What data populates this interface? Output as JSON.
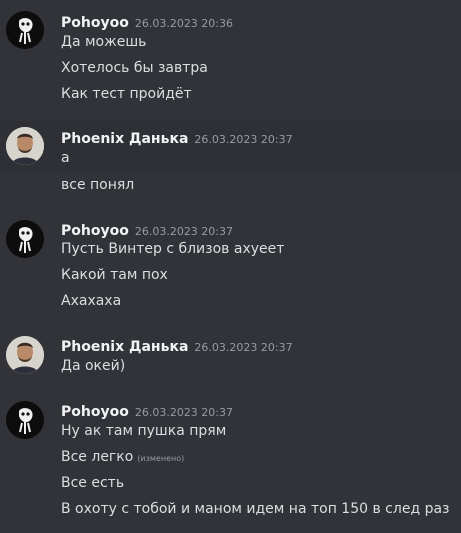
{
  "groups": [
    {
      "author": "Pohoyoo",
      "timestamp": "26.03.2023 20:36",
      "avatar": "dark-sketch-avatar",
      "messages": [
        "Да можешь",
        "Хотелось бы завтра",
        "Как тест пройдёт"
      ]
    },
    {
      "author": "Phoenix Данька",
      "timestamp": "26.03.2023 20:37",
      "avatar": "photo-avatar",
      "messages": [
        "а",
        "все понял"
      ]
    },
    {
      "author": "Pohoyoo",
      "timestamp": "26.03.2023 20:37",
      "avatar": "dark-sketch-avatar",
      "messages": [
        "Пусть Винтер с близов ахуеет",
        "Какой там пох",
        "Ахахаха"
      ]
    },
    {
      "author": "Phoenix Данька",
      "timestamp": "26.03.2023 20:37",
      "avatar": "photo-avatar",
      "messages": [
        "Да окей)"
      ]
    },
    {
      "author": "Pohoyoo",
      "timestamp": "26.03.2023 20:37",
      "avatar": "dark-sketch-avatar",
      "messages": [
        "Ну ак там пушка прям",
        "Все легко",
        "Все есть",
        "В охоту с тобой и маном идем на топ 150 в след раз"
      ],
      "edited_label": "(изменено)"
    }
  ],
  "colors": {
    "background": "#313338",
    "highlight": "#2e3035",
    "author": "#f2f3f5",
    "text": "#dbdee1",
    "muted": "#949ba4"
  }
}
